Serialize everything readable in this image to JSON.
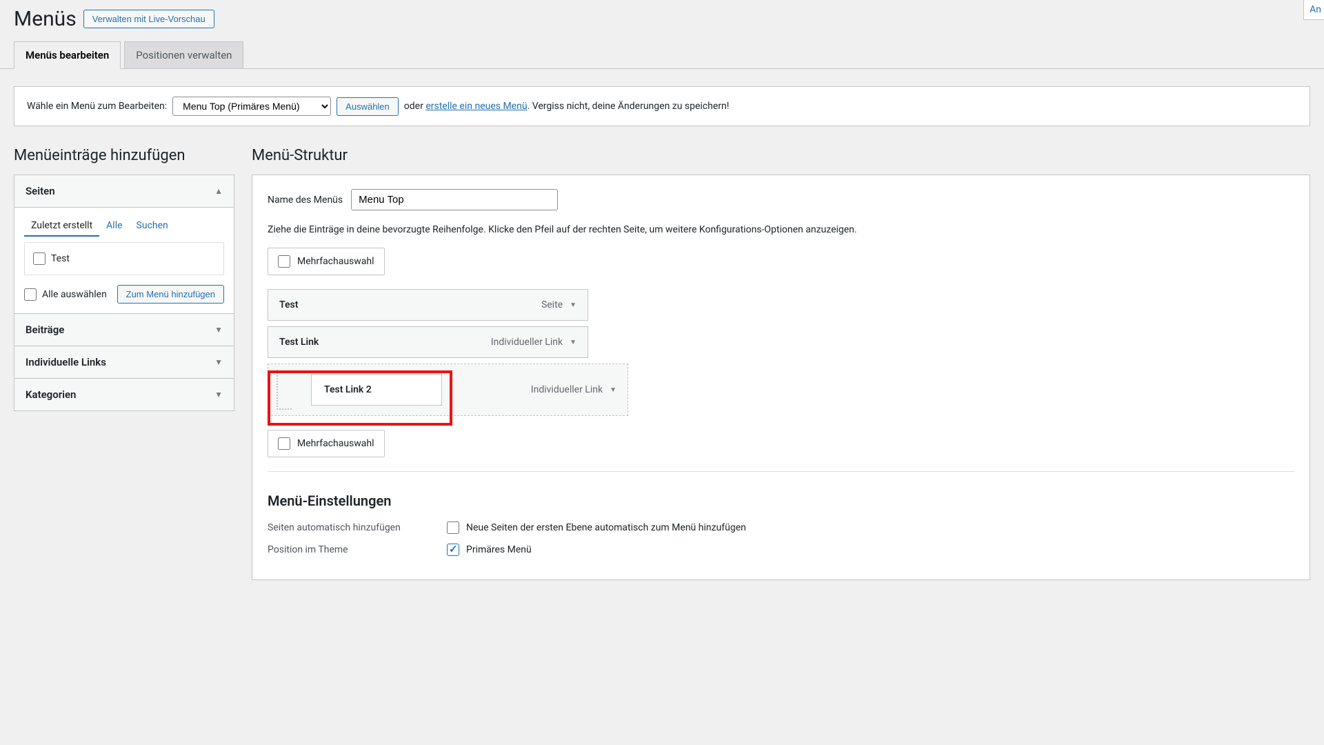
{
  "header": {
    "title": "Menüs",
    "live_preview_btn": "Verwalten mit Live-Vorschau",
    "top_right": "An"
  },
  "tabs": {
    "edit": "Menüs bearbeiten",
    "positions": "Positionen verwalten"
  },
  "select_bar": {
    "label": "Wähle ein Menü zum Bearbeiten:",
    "selected": "Menu Top (Primäres Menü)",
    "choose_btn": "Auswählen",
    "or": "oder",
    "create_link": "erstelle ein neues Menü",
    "tail": ". Vergiss nicht, deine Änderungen zu speichern!"
  },
  "left": {
    "title": "Menüeinträge hinzufügen",
    "panels": {
      "pages": "Seiten",
      "posts": "Beiträge",
      "links": "Individuelle Links",
      "categories": "Kategorien"
    },
    "subtabs": {
      "recent": "Zuletzt erstellt",
      "all": "Alle",
      "search": "Suchen"
    },
    "page_item": "Test",
    "select_all": "Alle auswählen",
    "add_btn": "Zum Menü hinzufügen"
  },
  "right": {
    "title": "Menü-Struktur",
    "name_label": "Name des Menüs",
    "name_value": "Menu Top",
    "help": "Ziehe die Einträge in deine bevorzugte Reihenfolge. Klicke den Pfeil auf der rechten Seite, um weitere Konfigurations-Optionen anzuzeigen.",
    "multi": "Mehrfachauswahl",
    "items": [
      {
        "label": "Test",
        "type": "Seite"
      },
      {
        "label": "Test Link",
        "type": "Individueller Link"
      },
      {
        "label": "Test Link 2",
        "type": "Individueller Link"
      }
    ],
    "settings": {
      "title": "Menü-Einstellungen",
      "auto_label": "Seiten automatisch hinzufügen",
      "auto_cb": "Neue Seiten der ersten Ebene automatisch zum Menü hinzufügen",
      "pos_label": "Position im Theme",
      "pos_primary": "Primäres Menü"
    }
  }
}
